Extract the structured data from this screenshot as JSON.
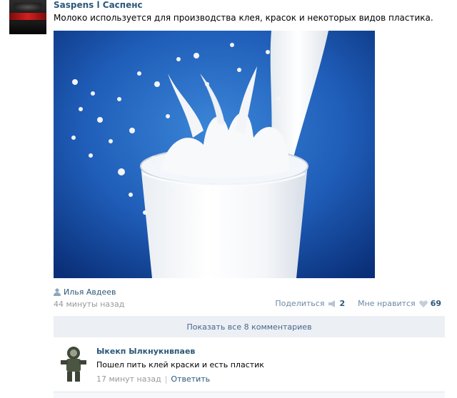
{
  "post": {
    "author": "Saspens l Саспенс",
    "text": "Молоко используется для производства клея, красок и некоторых видов пластика.",
    "signer": "Илья Авдеев",
    "time": "44 минуты назад",
    "avatar_text": "SASPENS"
  },
  "actions": {
    "share_label": "Поделиться",
    "share_count": "2",
    "like_label": "Мне нравится",
    "like_count": "69"
  },
  "comments": {
    "show_all_label": "Показать все 8 комментариев",
    "items": [
      {
        "author": "Ыкекп Ылкнукнвпаев",
        "text": "Пошел пить клей краски и есть пластик",
        "time": "17 минут назад",
        "reply_label": "Ответить"
      }
    ]
  },
  "colors": {
    "link": "#2b587a",
    "muted": "#999999",
    "panel": "#eceff3"
  }
}
